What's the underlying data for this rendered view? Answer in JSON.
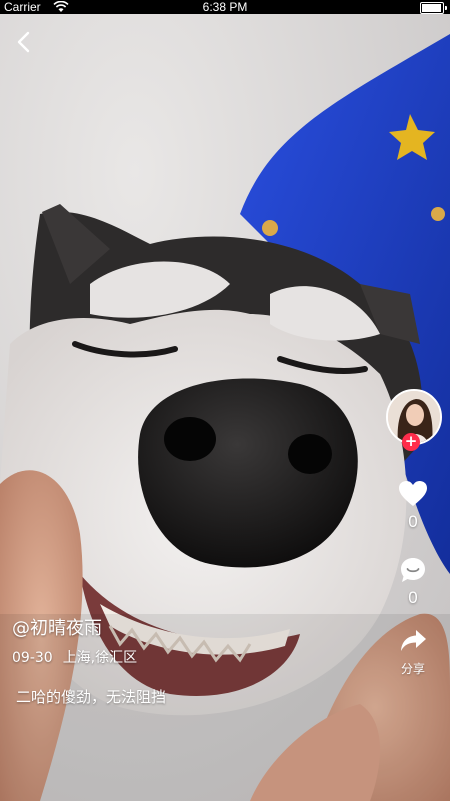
{
  "status_bar": {
    "carrier": "Carrier",
    "time": "6:38 PM"
  },
  "video": {
    "subject": "husky-dog"
  },
  "actions": {
    "like_count": "0",
    "comment_count": "0",
    "share_label": "分享"
  },
  "post": {
    "author": "@初晴夜雨",
    "date": "09-30",
    "location": "上海,徐汇区",
    "caption": "二哈的傻劲，无法阻挡"
  },
  "colors": {
    "follow_badge": "#ff2d4b",
    "background_blanket": "#1c3fc4"
  },
  "icons": [
    "back-icon",
    "heart-icon",
    "comment-icon",
    "share-icon",
    "plus-icon",
    "wifi-icon",
    "battery-icon"
  ]
}
